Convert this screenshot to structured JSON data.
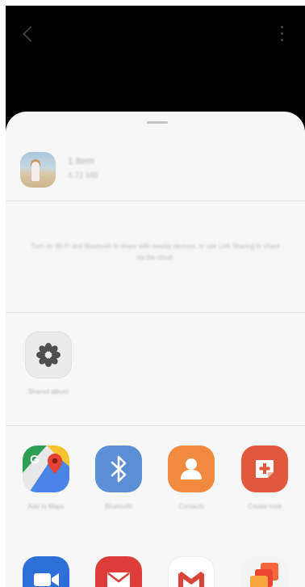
{
  "topbar": {
    "back_icon": "chevron-left-icon",
    "more_icon": "more-vertical-icon"
  },
  "file": {
    "name": "1 item",
    "meta": "4.72 MB"
  },
  "hint": "Turn on Wi-Fi and Bluetooth to share with nearby devices, or use Link Sharing to share via the cloud.",
  "album": {
    "label": "Shared album",
    "icon": "flower-icon"
  },
  "apps": [
    {
      "label": "Add to Maps",
      "icon": "google-maps-icon"
    },
    {
      "label": "Bluetooth",
      "icon": "bluetooth-icon"
    },
    {
      "label": "Contacts",
      "icon": "contact-icon"
    },
    {
      "label": "Create note",
      "icon": "note-plus-icon"
    },
    {
      "label": "",
      "icon": "zoom-video-icon"
    },
    {
      "label": "",
      "icon": "email-icon"
    },
    {
      "label": "",
      "icon": "gmail-icon"
    },
    {
      "label": "",
      "icon": "office-icon"
    }
  ],
  "colors": {
    "sheet": "#f7f7f7",
    "bluetooth": "#5c8ed6",
    "contacts": "#f08a3e",
    "reminder": "#e0573d",
    "zoom": "#2d6fd8",
    "mail": "#dc3c3a"
  }
}
